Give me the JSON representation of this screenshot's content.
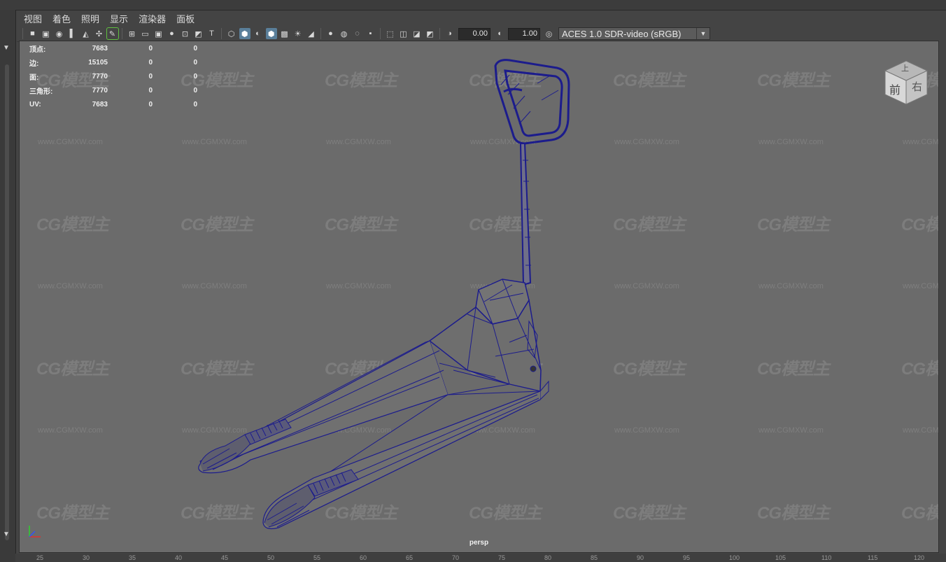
{
  "menu": [
    "视图",
    "着色",
    "照明",
    "显示",
    "渲染器",
    "面板"
  ],
  "toolbar": {
    "exposure": "0.00",
    "gamma": "1.00",
    "color_space": "ACES 1.0 SDR-video (sRGB)"
  },
  "hud": {
    "rows": [
      {
        "label": "顶点:",
        "v1": "7683",
        "v2": "0",
        "v3": "0"
      },
      {
        "label": "边:",
        "v1": "15105",
        "v2": "0",
        "v3": "0"
      },
      {
        "label": "面:",
        "v1": "7770",
        "v2": "0",
        "v3": "0"
      },
      {
        "label": "三角形:",
        "v1": "7770",
        "v2": "0",
        "v3": "0"
      },
      {
        "label": "UV:",
        "v1": "7683",
        "v2": "0",
        "v3": "0"
      }
    ]
  },
  "viewcube": {
    "top": "上",
    "front": "前",
    "right": "右"
  },
  "camera": "persp",
  "watermark": {
    "logo": "CG模型主",
    "url": "www.CGMXW.com"
  },
  "ruler": [
    "25",
    "30",
    "35",
    "40",
    "45",
    "50",
    "55",
    "60",
    "65",
    "70",
    "75",
    "80",
    "85",
    "90",
    "95",
    "100",
    "105",
    "110",
    "115",
    "120"
  ],
  "colors": {
    "wireframe": "#1c1c8c",
    "viewport_bg": "#6b6b6b",
    "active_icon": "#5a7f9a"
  }
}
